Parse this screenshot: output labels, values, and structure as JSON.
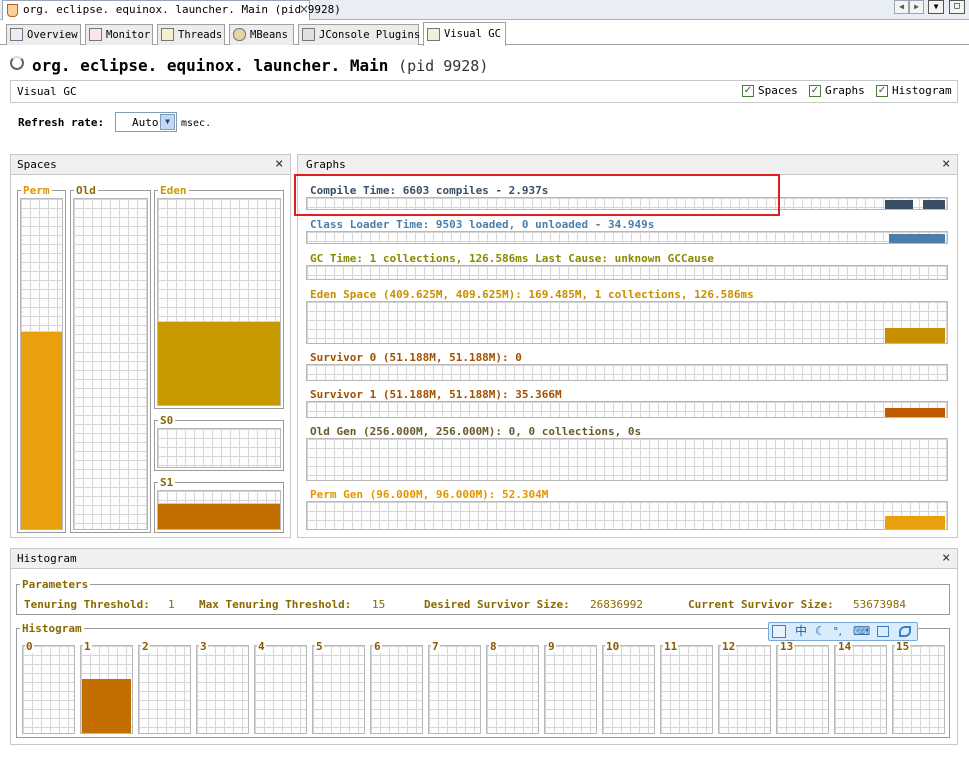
{
  "doc_tab": {
    "label": "org. eclipse. equinox. launcher. Main (pid 9928)",
    "close": "×"
  },
  "nav_arrows": {
    "left": "◀",
    "right": "▶",
    "menu": "▼",
    "restore": "□"
  },
  "tabs": [
    {
      "label": "Overview",
      "icon": "overview-icon"
    },
    {
      "label": "Monitor",
      "icon": "monitor-icon"
    },
    {
      "label": "Threads",
      "icon": "threads-icon"
    },
    {
      "label": "MBeans",
      "icon": "mbeans-icon"
    },
    {
      "label": "JConsole Plugins",
      "icon": "plugins-icon"
    },
    {
      "label": "Visual GC",
      "icon": "visualgc-icon"
    }
  ],
  "app": {
    "main_class": "org. eclipse. equinox. launcher. Main",
    "pid": "(pid 9928)"
  },
  "visualgc": {
    "title": "Visual GC",
    "checkboxes": {
      "spaces": "Spaces",
      "graphs": "Graphs",
      "histogram": "Histogram"
    },
    "refresh_label": "Refresh rate:",
    "refresh_value": "Auto",
    "refresh_unit": "msec."
  },
  "spaces": {
    "title": "Spaces",
    "perm": "Perm",
    "old": "Old",
    "eden": "Eden",
    "s0": "S0",
    "s1": "S1",
    "levels": {
      "perm": 0.6,
      "old": 0.0,
      "eden": 0.41,
      "s0": 0.0,
      "s1": 0.69
    }
  },
  "graphs": {
    "title": "Graphs",
    "compile": "Compile Time: 6603 compiles - 2.937s",
    "classloader": "Class Loader Time: 9503 loaded, 0 unloaded - 34.949s",
    "gc": "GC Time: 1 collections, 126.586ms Last Cause: unknown GCCause",
    "eden": "Eden Space (409.625M, 409.625M): 169.485M, 1 collections, 126.586ms",
    "s0": "Survivor 0 (51.188M, 51.188M): 0",
    "s1": "Survivor 1 (51.188M, 51.188M): 35.366M",
    "old": "Old Gen (256.000M, 256.000M): 0, 0 collections, 0s",
    "perm": "Perm Gen (96.000M, 96.000M): 52.304M"
  },
  "histogram": {
    "title": "Histogram",
    "params_title": "Parameters",
    "tenuring_threshold_label": "Tenuring Threshold:",
    "tenuring_threshold": "1",
    "max_tenuring_label": "Max Tenuring Threshold:",
    "max_tenuring": "15",
    "desired_survivor_label": "Desired Survivor Size:",
    "desired_survivor": "26836992",
    "current_survivor_label": "Current Survivor Size:",
    "current_survivor": "53673984",
    "hist_title": "Histogram",
    "bins": [
      "0",
      "1",
      "2",
      "3",
      "4",
      "5",
      "6",
      "7",
      "8",
      "9",
      "10",
      "11",
      "12",
      "13",
      "14",
      "15"
    ],
    "bin_levels": [
      0,
      0.62,
      0,
      0,
      0,
      0,
      0,
      0,
      0,
      0,
      0,
      0,
      0,
      0,
      0,
      0
    ]
  },
  "ime_toolbar": {
    "chars": [
      "中",
      "☾",
      "°,",
      "⌨"
    ]
  },
  "colors": {
    "perm": "#e8a00c",
    "eden": "#c99a00",
    "s1": "#c46e00",
    "old_title": "#8a6a00",
    "compile": "#3a4f66",
    "classloader": "#4a7ea8",
    "gc": "#8a8a00",
    "eden_graph": "#c58f00",
    "s1_graph": "#c05a00",
    "perm_graph": "#e8a00c",
    "highlight": "#e02020"
  }
}
